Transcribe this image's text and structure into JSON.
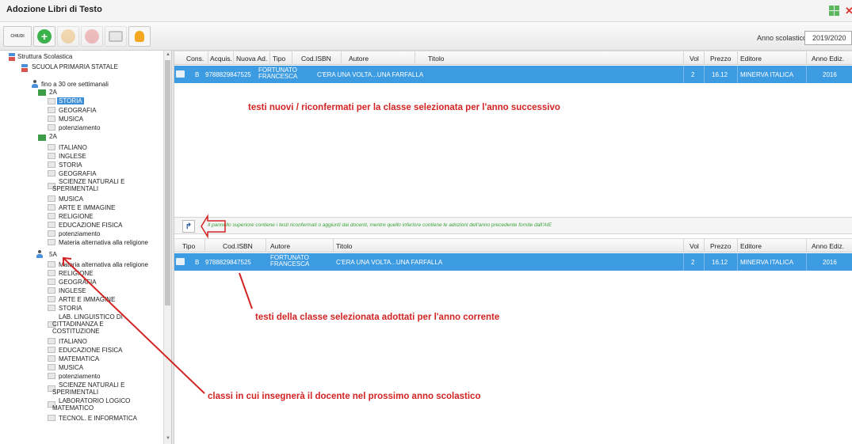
{
  "window": {
    "title": "Adozione Libri di Testo"
  },
  "toolbar": {
    "close_label": "CHIUDI",
    "year_label": "Anno scolastico",
    "year_value": "2019/2020"
  },
  "tree": {
    "root": "Struttura Scolastica",
    "school": "SCUOLA PRIMARIA STATALE",
    "hours": "fino a 30 ore settimanali",
    "class_2a_first": {
      "label": "2A",
      "subjects": [
        "STORIA",
        "GEOGRAFIA",
        "MUSICA",
        "potenziamento"
      ]
    },
    "class_2a_second": {
      "label": "2A",
      "subjects": [
        "ITALIANO",
        "INGLESE",
        "STORIA",
        "GEOGRAFIA",
        "SCIENZE NATURALI E SPERIMENTALI",
        "MUSICA",
        "ARTE E IMMAGINE",
        "RELIGIONE",
        "EDUCAZIONE FISICA",
        "potenziamento",
        "Materia alternativa alla religione"
      ]
    },
    "class_5a": {
      "label": "5A",
      "subjects": [
        "Materia alternativa alla religione",
        "RELIGIONE",
        "GEOGRAFIA",
        "INGLESE",
        "ARTE E IMMAGINE",
        "STORIA",
        "LAB. LINGUISTICO DI CITTADINANZA E COSTITUZIONE",
        "ITALIANO",
        "EDUCAZIONE FISICA",
        "MATEMATICA",
        "MUSICA",
        "potenziamento",
        "SCIENZE NATURALI E SPERIMENTALI",
        "LABORATORIO LOGICO MATEMATICO",
        "TECNOL. E INFORMATICA"
      ]
    }
  },
  "top_table": {
    "headers": {
      "cons": "Cons.",
      "acquis": "Acquis.",
      "nuova": "Nuova Ad.",
      "tipo": "Tipo",
      "isbn": "Cod.ISBN",
      "autore": "Autore",
      "titolo": "Titolo",
      "vol": "Vol",
      "prezzo": "Prezzo",
      "editore": "Editore",
      "anno": "Anno Ediz."
    },
    "row": {
      "tipo": "B",
      "isbn": "9788829847525",
      "autore": "FORTUNATO FRANCESCA",
      "titolo": "C'ERA UNA VOLTA...UNA FARFALLA",
      "vol": "2",
      "prezzo": "16.12",
      "editore": "MINERVA ITALICA",
      "anno": "2016"
    }
  },
  "middle_bar": {
    "note": "Il pannello superiore contiene i testi riconfermati o aggiunti dai docenti, mentre quello inferiore contiene le adozioni dell'anno precedente fornite dall'AIE"
  },
  "bottom_table": {
    "headers": {
      "tipo": "Tipo",
      "isbn": "Cod.ISBN",
      "autore": "Autore",
      "titolo": "Titolo",
      "vol": "Vol",
      "prezzo": "Prezzo",
      "editore": "Editore",
      "anno": "Anno Ediz."
    },
    "row": {
      "tipo": "B",
      "isbn": "9788829847525",
      "autore": "FORTUNATO FRANCESCA",
      "titolo": "C'ERA UNA VOLTA...UNA FARFALLA",
      "vol": "2",
      "prezzo": "16.12",
      "editore": "MINERVA ITALICA",
      "anno": "2016"
    }
  },
  "annotations": {
    "top": "testi nuovi / riconfermati per la classe selezionata per l'anno successivo",
    "bottom": "testi della classe selezionata adottati per l'anno corrente",
    "left": "classi in cui insegnerà il docente nel prossimo anno scolastico"
  },
  "colors": {
    "selection_blue": "#3d9be2",
    "annotation_red": "#d32424",
    "note_green": "#3aa33a"
  }
}
